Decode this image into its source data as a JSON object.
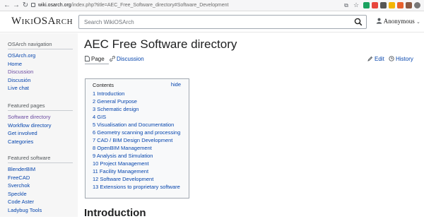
{
  "browser": {
    "url_host": "wiki.osarch.org",
    "url_path": "/index.php?title=AEC_Free_Software_directory#Software_Development",
    "icons": [
      "back-icon",
      "forward-icon",
      "reload-icon",
      "lock-icon",
      "translate-icon",
      "bookmark-star-icon"
    ],
    "extension_colors": [
      "#1aa260",
      "#e8453c",
      "#555555",
      "#f4b400",
      "#e8602c",
      "#8a5a44",
      "#777777"
    ]
  },
  "site": {
    "logo": "WikiOSArch",
    "search_placeholder": "Search WikiOSArch",
    "user": "Anonymous"
  },
  "sidebar": {
    "sections": [
      {
        "heading": "OSArch navigation",
        "items": [
          {
            "label": "OSArch.org",
            "visited": false
          },
          {
            "label": "Home",
            "visited": false
          },
          {
            "label": "Discussion",
            "visited": true
          },
          {
            "label": "Discusión",
            "visited": false
          },
          {
            "label": "Live chat",
            "visited": false
          }
        ]
      },
      {
        "heading": "Featured pages",
        "items": [
          {
            "label": "Software directory",
            "visited": true
          },
          {
            "label": "Workflow directory",
            "visited": false
          },
          {
            "label": "Get involved",
            "visited": false
          },
          {
            "label": "Categories",
            "visited": false
          }
        ]
      },
      {
        "heading": "Featured software",
        "items": [
          {
            "label": "BlenderBIM",
            "visited": false
          },
          {
            "label": "FreeCAD",
            "visited": false
          },
          {
            "label": "Sverchok",
            "visited": false
          },
          {
            "label": "Speckle",
            "visited": false
          },
          {
            "label": "Code Aster",
            "visited": false
          },
          {
            "label": "Ladybug Tools",
            "visited": false
          }
        ]
      }
    ]
  },
  "page": {
    "title": "AEC Free Software directory",
    "tabs": {
      "page": "Page",
      "discussion": "Discussion",
      "edit": "Edit",
      "history": "History"
    },
    "toc": {
      "title": "Contents",
      "hide": "hide",
      "items": [
        "1 Introduction",
        "2 General Purpose",
        "3 Schematic design",
        "4 GIS",
        "5 Visualisation and Documentation",
        "6 Geometry scanning and processing",
        "7 CAD / BIM Design Development",
        "8 OpenBIM Management",
        "9 Analysis and Simulation",
        "10 Project Management",
        "11 Facility Management",
        "12 Software Development",
        "13 Extensions to proprietary software"
      ]
    },
    "first_heading": "Introduction"
  }
}
